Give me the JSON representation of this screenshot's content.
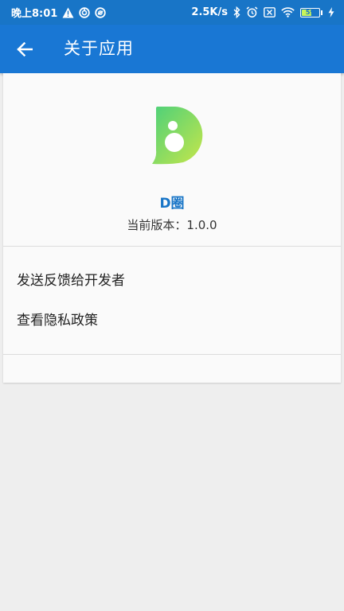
{
  "status_bar": {
    "time": "晚上8:01",
    "network_speed": "2.5K/s",
    "battery_level": "59",
    "battery_percent": 59,
    "icons": [
      "warning-icon",
      "sync-icon",
      "sync-alt-icon",
      "bluetooth-icon",
      "alarm-icon",
      "sim-off-icon",
      "wifi-icon",
      "battery-icon",
      "charging-icon"
    ]
  },
  "app_bar": {
    "title": "关于应用",
    "back_icon": "arrow-left-icon"
  },
  "about": {
    "app_name": "D圈",
    "version_label": "当前版本：",
    "version_value": "1.0.0"
  },
  "menu": {
    "items": [
      {
        "label": "发送反馈给开发者"
      },
      {
        "label": "查看隐私政策"
      }
    ]
  },
  "colors": {
    "status_bar": "#1875c7",
    "app_bar": "#1977d4",
    "accent_text": "#1875c7",
    "logo_gradient_start": "#4cd07a",
    "logo_gradient_end": "#c6e64a",
    "background": "#eeeeee",
    "card": "#fafafa"
  }
}
